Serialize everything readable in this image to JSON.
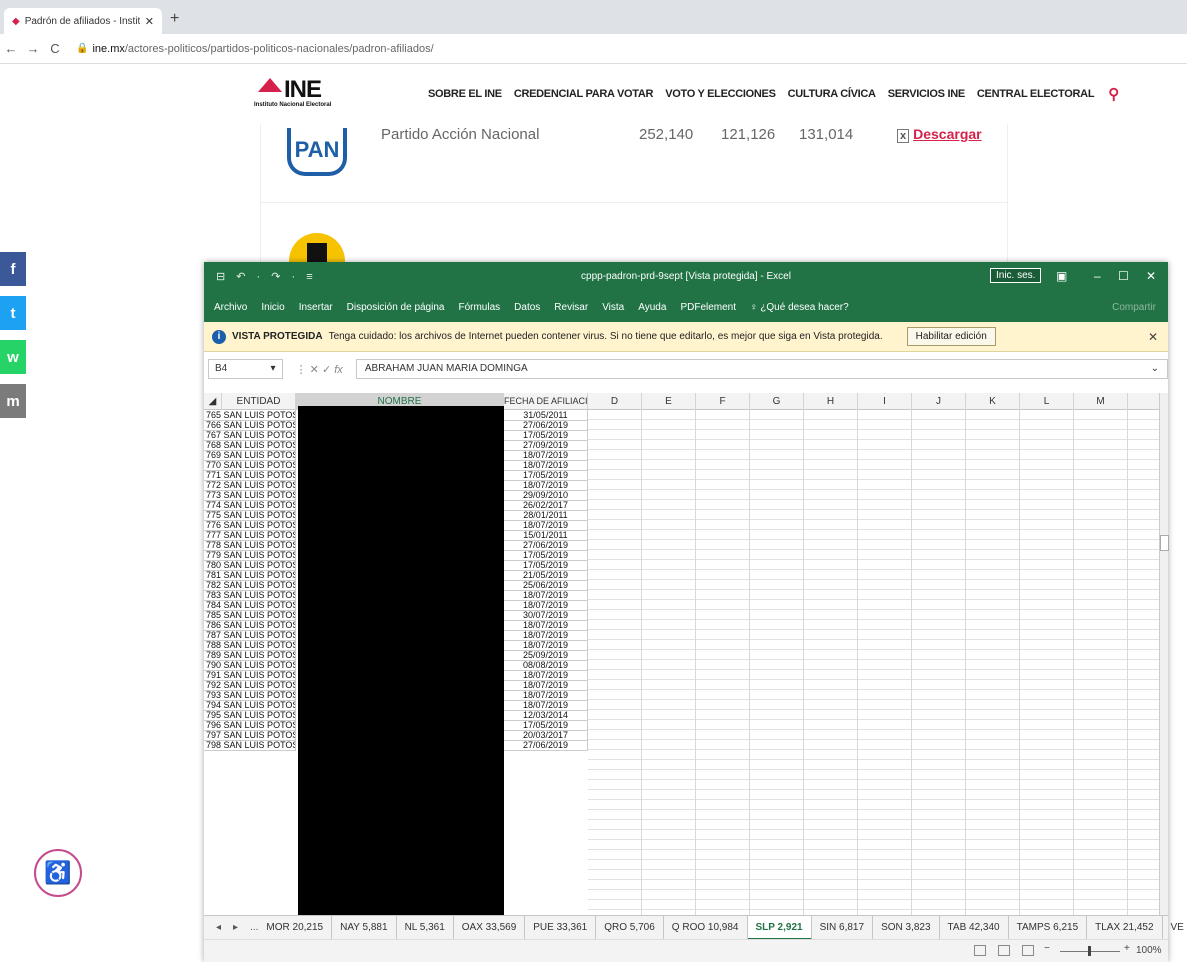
{
  "browser": {
    "tab_title": "Padrón de afiliados - Instituto N...",
    "new_tab": "+",
    "url_host": "ine.mx",
    "url_path": "/actores-politicos/partidos-politicos-nacionales/padron-afiliados/"
  },
  "site": {
    "logo_text": "INE",
    "logo_sub": "Instituto Nacional Electoral",
    "nav": [
      "SOBRE EL INE",
      "CREDENCIAL PARA VOTAR",
      "VOTO Y ELECCIONES",
      "CULTURA CÍVICA",
      "SERVICIOS INE",
      "CENTRAL ELECTORAL"
    ],
    "party_logo": "PAN",
    "party_name": "Partido Acción Nacional",
    "total": "252,140",
    "mujeres": "121,126",
    "hombres": "131,014",
    "descargar": "Descargar",
    "social": [
      "f",
      "t",
      "w",
      "m"
    ]
  },
  "excel": {
    "qat": "⊟ ↶ · ↷ · ≡",
    "title": "cppp-padron-prd-9sept [Vista protegida] - Excel",
    "signin": "Inic. ses.",
    "menu": [
      "Archivo",
      "Inicio",
      "Insertar",
      "Disposición de página",
      "Fórmulas",
      "Datos",
      "Revisar",
      "Vista",
      "Ayuda",
      "PDFelement",
      "¿Qué desea hacer?"
    ],
    "share": "Compartir",
    "pv_title": "VISTA PROTEGIDA",
    "pv_text": "Tenga cuidado: los archivos de Internet pueden contener virus. Si no tiene que editarlo, es mejor que siga en Vista protegida.",
    "pv_button": "Habilitar edición",
    "namebox": "B4",
    "formula": "ABRAHAM JUAN MARIA DOMINGA",
    "col_entidad": "ENTIDAD",
    "col_nombre": "NOMBRE",
    "col_fecha": "FECHA DE AFILIACIÓN",
    "columns": [
      "D",
      "E",
      "F",
      "G",
      "H",
      "I",
      "J",
      "K",
      "L",
      "M"
    ],
    "rows": [
      {
        "n": "765",
        "e": "SAN LUIS POTOSÍ",
        "f": "31/05/2011"
      },
      {
        "n": "766",
        "e": "SAN LUIS POTOSÍ",
        "f": "27/06/2019"
      },
      {
        "n": "767",
        "e": "SAN LUIS POTOSÍ",
        "f": "17/05/2019"
      },
      {
        "n": "768",
        "e": "SAN LUIS POTOSÍ",
        "f": "27/09/2019"
      },
      {
        "n": "769",
        "e": "SAN LUIS POTOSÍ",
        "f": "18/07/2019"
      },
      {
        "n": "770",
        "e": "SAN LUIS POTOSÍ",
        "f": "18/07/2019"
      },
      {
        "n": "771",
        "e": "SAN LUIS POTOSÍ",
        "f": "17/05/2019"
      },
      {
        "n": "772",
        "e": "SAN LUIS POTOSÍ",
        "f": "18/07/2019"
      },
      {
        "n": "773",
        "e": "SAN LUIS POTOSÍ",
        "f": "29/09/2010"
      },
      {
        "n": "774",
        "e": "SAN LUIS POTOSÍ",
        "f": "26/02/2017"
      },
      {
        "n": "775",
        "e": "SAN LUIS POTOSÍ",
        "f": "28/01/2011"
      },
      {
        "n": "776",
        "e": "SAN LUIS POTOSÍ",
        "f": "18/07/2019"
      },
      {
        "n": "777",
        "e": "SAN LUIS POTOSÍ",
        "f": "15/01/2011"
      },
      {
        "n": "778",
        "e": "SAN LUIS POTOSÍ",
        "f": "27/06/2019"
      },
      {
        "n": "779",
        "e": "SAN LUIS POTOSÍ",
        "f": "17/05/2019"
      },
      {
        "n": "780",
        "e": "SAN LUIS POTOSÍ",
        "f": "17/05/2019"
      },
      {
        "n": "781",
        "e": "SAN LUIS POTOSÍ",
        "f": "21/05/2019"
      },
      {
        "n": "782",
        "e": "SAN LUIS POTOSÍ",
        "f": "25/06/2019"
      },
      {
        "n": "783",
        "e": "SAN LUIS POTOSÍ",
        "f": "18/07/2019"
      },
      {
        "n": "784",
        "e": "SAN LUIS POTOSÍ",
        "f": "18/07/2019"
      },
      {
        "n": "785",
        "e": "SAN LUIS POTOSÍ",
        "f": "30/07/2019"
      },
      {
        "n": "786",
        "e": "SAN LUIS POTOSÍ",
        "f": "18/07/2019"
      },
      {
        "n": "787",
        "e": "SAN LUIS POTOSÍ",
        "f": "18/07/2019"
      },
      {
        "n": "788",
        "e": "SAN LUIS POTOSÍ",
        "f": "18/07/2019"
      },
      {
        "n": "789",
        "e": "SAN LUIS POTOSÍ",
        "f": "25/09/2019"
      },
      {
        "n": "790",
        "e": "SAN LUIS POTOSÍ",
        "f": "08/08/2019"
      },
      {
        "n": "791",
        "e": "SAN LUIS POTOSÍ",
        "f": "18/07/2019"
      },
      {
        "n": "792",
        "e": "SAN LUIS POTOSÍ",
        "f": "18/07/2019"
      },
      {
        "n": "793",
        "e": "SAN LUIS POTOSÍ",
        "f": "18/07/2019"
      },
      {
        "n": "794",
        "e": "SAN LUIS POTOSÍ",
        "f": "18/07/2019"
      },
      {
        "n": "795",
        "e": "SAN LUIS POTOSÍ",
        "f": "12/03/2014"
      },
      {
        "n": "796",
        "e": "SAN LUIS POTOSÍ",
        "f": "17/05/2019"
      },
      {
        "n": "797",
        "e": "SAN LUIS POTOSÍ",
        "f": "20/03/2017"
      },
      {
        "n": "798",
        "e": "SAN LUIS POTOSÍ",
        "f": "27/06/2019"
      }
    ],
    "sheets": [
      "...",
      "MOR 20,215",
      "NAY 5,881",
      "NL 5,361",
      "OAX 33,569",
      "PUE 33,361",
      "QRO 5,706",
      "Q ROO 10,984",
      "SLP 2,921",
      "SIN 6,817",
      "SON 3,823",
      "TAB 42,340",
      "TAMPS 6,215",
      "TLAX 21,452",
      "VE ..."
    ],
    "active_sheet": "SLP 2,921",
    "zoom": "100%"
  }
}
